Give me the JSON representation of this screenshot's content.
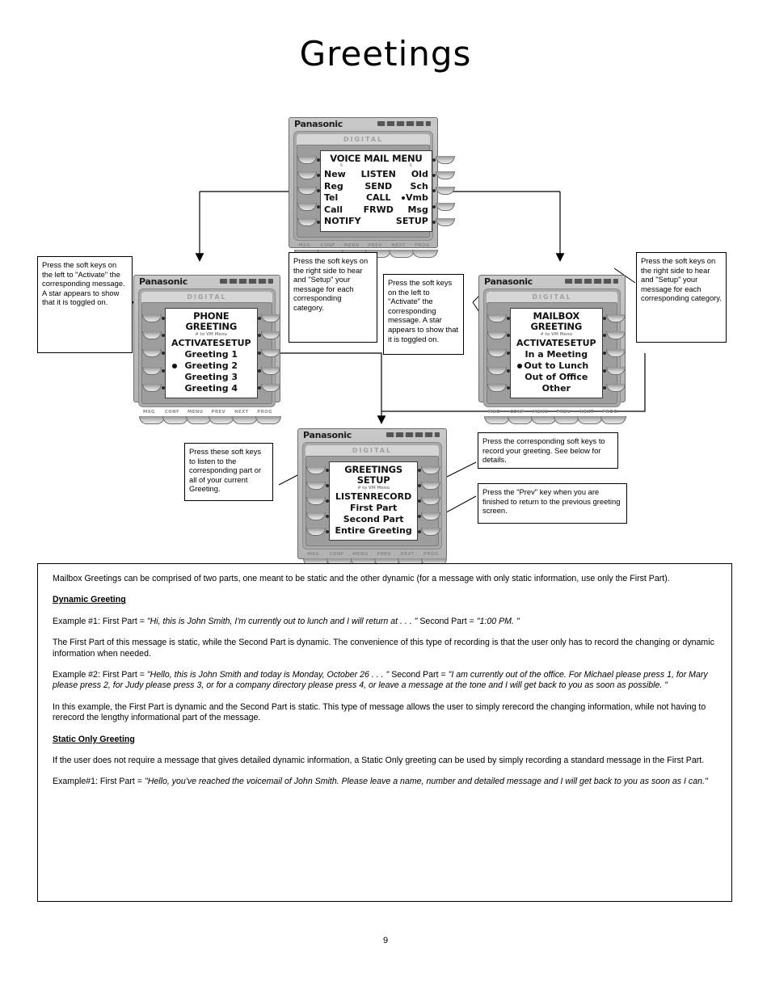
{
  "page": {
    "title": "Greetings",
    "number": "9"
  },
  "phone_brand": "Panasonic",
  "digital_label": "DIGITAL",
  "bottom_keys": [
    "MSG",
    "CONF",
    "MENU",
    "PREV",
    "NEXT",
    "PROG"
  ],
  "phones": {
    "voice_mail_menu": {
      "title": "VOICE MAIL MENU",
      "num_left": "6",
      "num_right": "5",
      "rows": [
        {
          "left": "New",
          "mid": "LISTEN",
          "right": "Old",
          "right_bullet": false
        },
        {
          "left": "Reg",
          "mid": "SEND",
          "right": "Sch",
          "right_bullet": false
        },
        {
          "left": "Tel",
          "mid": "CALL",
          "right": "Vmb",
          "right_bullet": true
        },
        {
          "left": "Call",
          "mid": "FRWD",
          "right": "Msg",
          "right_bullet": false
        },
        {
          "left": "NOTIFY",
          "mid": "",
          "right": "SETUP",
          "right_bullet": false
        }
      ]
    },
    "phone_greeting": {
      "title": "PHONE GREETING",
      "subtitle": "# to VM Menu",
      "activate_label": "ACTIVATE",
      "setup_label": "SETUP",
      "items": [
        {
          "label": "Greeting 1",
          "star": false
        },
        {
          "label": "Greeting 2",
          "star": true
        },
        {
          "label": "Greeting 3",
          "star": false
        },
        {
          "label": "Greeting 4",
          "star": false
        }
      ]
    },
    "mailbox_greeting": {
      "title": "MAILBOX GREETING",
      "subtitle": "# to VM Menu",
      "activate_label": "ACTIVATE",
      "setup_label": "SETUP",
      "items": [
        {
          "label": "In a Meeting",
          "star": false
        },
        {
          "label": "Out to Lunch",
          "star": true
        },
        {
          "label": "Out of Office",
          "star": false
        },
        {
          "label": "Other",
          "star": false
        }
      ]
    },
    "greetings_setup": {
      "title": "GREETINGS SETUP",
      "subtitle": "# to VM Menu",
      "listen_label": "LISTEN",
      "record_label": "RECORD",
      "items": [
        {
          "label": "First Part",
          "star": false
        },
        {
          "label": "Second Part",
          "star": false
        },
        {
          "label": "Entire Greeting",
          "star": false
        }
      ]
    }
  },
  "callouts": {
    "left_activate": "Press the soft keys on the left to \"Activate\" the corresponding message.  A star appears to show that it is toggled on.",
    "mid_setup": "Press the soft keys on the right side to hear and \"Setup\" your message for each corresponding category.",
    "mid_activate": "Press the soft keys on the left to \"Activate\" the corresponding message.  A star appears to show that it is toggled on.",
    "right_setup": "Press the soft keys on the right side to hear and \"Setup\" your message for each corresponding category.",
    "listen": "Press these soft keys to listen to the corresponding part or all of your current Greeting.",
    "record": "Press the corresponding soft keys to record your greeting.  See below for details.",
    "prev": "Press the \"Prev\" key when you are finished to return to the previous greeting screen."
  },
  "body": {
    "intro": "Mailbox Greetings can be comprised of two parts, one meant to be static and the other dynamic (for a message with only static information, use only the First Part).",
    "dynamic_heading": "Dynamic Greeting",
    "example1_prefix": "Example #1:    First Part = ",
    "example1_first": "\"Hi, this is John Smith, I'm currently out to lunch and I will return at . . . \"",
    "example1_mid": "  Second Part = ",
    "example1_second": "\"1:00 PM. \"",
    "para1": "The First Part of this message is static, while the Second Part is dynamic.  The convenience of this type of recording is that the user only has to record the changing or dynamic information when needed.",
    "example2_prefix": "Example #2:    First Part = ",
    "example2_first": "\"Hello, this is John Smith and today is Monday, October 26 . . . \"",
    "example2_mid": "  Second Part = ",
    "example2_second": "\"I am currently out of the office.  For Michael please press 1, for Mary please press 2, for Judy please press 3, or for a company directory please press  4, or leave a message at the tone and I will get back to you as soon as possible. \"",
    "para2": "In this example, the First Part is dynamic and the Second Part is static.  This type of message allows the user to simply rerecord the changing information, while not having to rerecord the lengthy informational part of the message.",
    "static_heading": "Static Only Greeting",
    "para3": "If the user does not require a message that gives detailed dynamic information, a Static Only greeting can be used by simply recording a standard message in the First Part.",
    "example3_prefix": "Example#1:  First Part = ",
    "example3_first": "\"Hello, you've reached the voicemail of John Smith.  Please leave a name, number and detailed message and I will get back to you as soon as I can.\""
  }
}
